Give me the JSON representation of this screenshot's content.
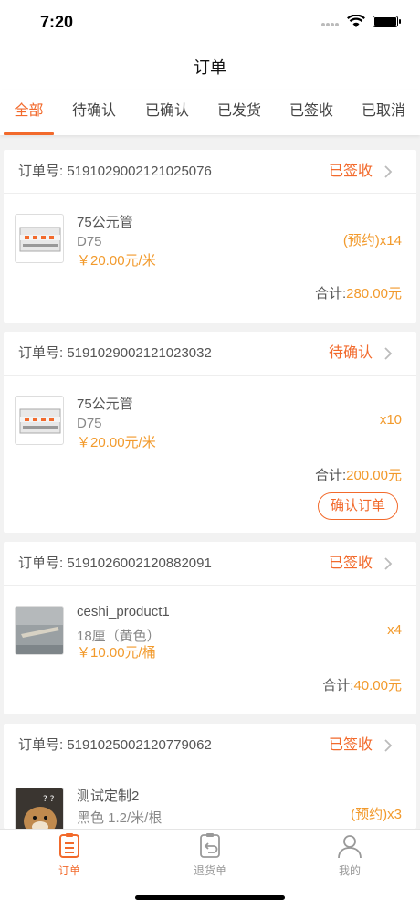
{
  "status_bar": {
    "time": "7:20"
  },
  "nav": {
    "title": "订单"
  },
  "tabs": [
    {
      "label": "全部",
      "active": true
    },
    {
      "label": "待确认"
    },
    {
      "label": "已确认"
    },
    {
      "label": "已发货"
    },
    {
      "label": "已签收"
    },
    {
      "label": "已取消"
    }
  ],
  "orders": [
    {
      "order_no": "订单号: 5191029002121025076",
      "status": "已签收",
      "item": {
        "name": "75公元管",
        "spec": "D75",
        "price": "￥20.00元/米",
        "qty": "(预约)x14",
        "thumb": "breaker-icon"
      },
      "total_label": "合计:",
      "total_amount": "280.00元"
    },
    {
      "order_no": "订单号: 5191029002121023032",
      "status": "待确认",
      "item": {
        "name": "75公元管",
        "spec": "D75",
        "price": "￥20.00元/米",
        "qty": "x10",
        "thumb": "breaker-icon"
      },
      "total_label": "合计:",
      "total_amount": "200.00元",
      "action": "确认订单"
    },
    {
      "order_no": "订单号: 5191026002120882091",
      "status": "已签收",
      "item": {
        "name": "ceshi_product1",
        "spec": "18厘（黄色）",
        "price": "￥10.00元/桶",
        "qty": "x4",
        "thumb": "tile-photo"
      },
      "total_label": "合计:",
      "total_amount": "40.00元"
    },
    {
      "order_no": "订单号: 5191025002120779062",
      "status": "已签收",
      "item": {
        "name": "测试定制2",
        "spec": "黑色 1.2/米/根",
        "qty": "(预约)x3",
        "thumb": "dog-photo"
      }
    }
  ],
  "tabbar": [
    {
      "label": "订单",
      "icon": "order-list-icon",
      "active": true
    },
    {
      "label": "退货单",
      "icon": "return-icon"
    },
    {
      "label": "我的",
      "icon": "user-icon"
    }
  ],
  "colors": {
    "accent": "#f26a2c",
    "price": "#f29a2c"
  }
}
